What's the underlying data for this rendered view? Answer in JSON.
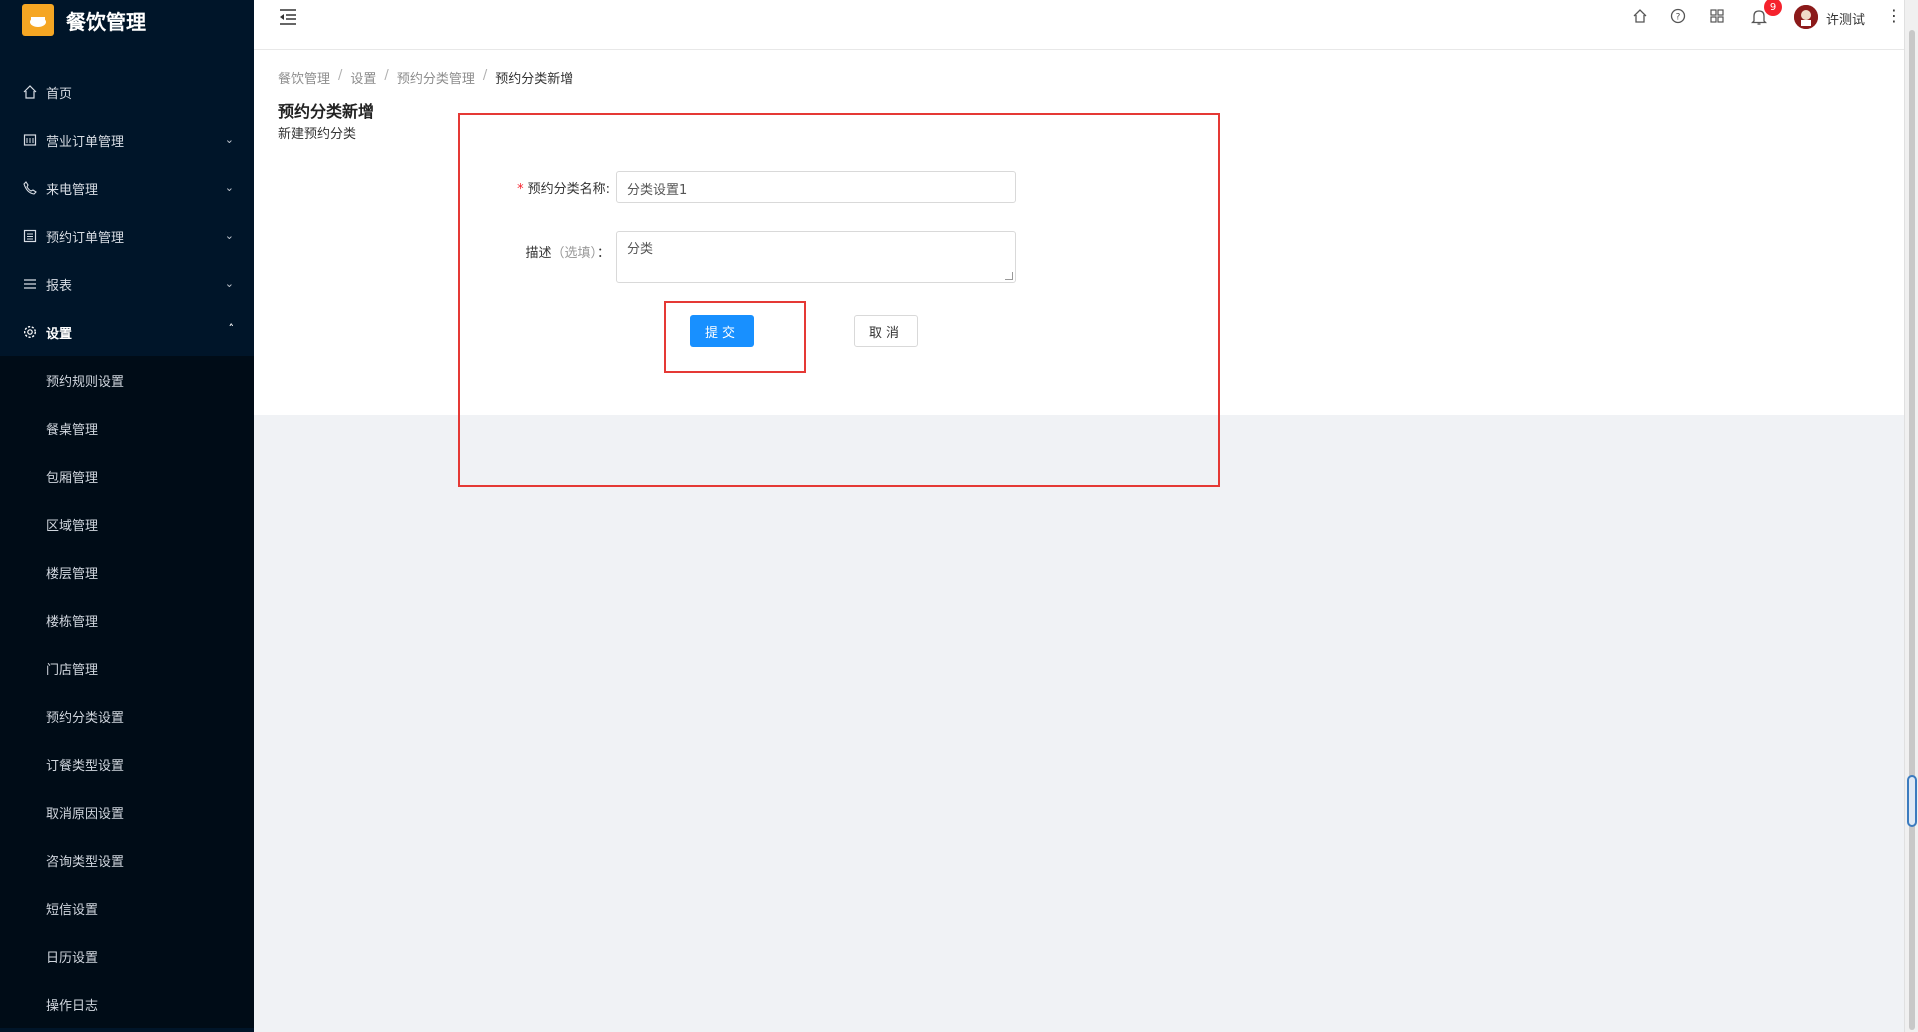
{
  "app": {
    "title": "餐饮管理"
  },
  "sidebar": {
    "items": [
      {
        "label": "首页",
        "icon": "home-icon"
      },
      {
        "label": "营业订单管理",
        "icon": "calendar-icon",
        "expandable": true
      },
      {
        "label": "来电管理",
        "icon": "phone-icon",
        "expandable": true
      },
      {
        "label": "预约订单管理",
        "icon": "list-icon",
        "expandable": true
      },
      {
        "label": "报表",
        "icon": "menu-icon",
        "expandable": true
      },
      {
        "label": "设置",
        "icon": "gear-icon",
        "expanded": true
      }
    ],
    "settings_sub": [
      "预约规则设置",
      "餐桌管理",
      "包厢管理",
      "区域管理",
      "楼层管理",
      "楼栋管理",
      "门店管理",
      "预约分类设置",
      "订餐类型设置",
      "取消原因设置",
      "咨询类型设置",
      "短信设置",
      "日历设置",
      "操作日志"
    ]
  },
  "header": {
    "notification_count": "9",
    "username": "许测试",
    "icons": [
      "home-icon",
      "help-icon",
      "apps-icon",
      "bell-icon",
      "avatar",
      "more-icon"
    ]
  },
  "breadcrumb": [
    "餐饮管理",
    "设置",
    "预约分类管理",
    "预约分类新增"
  ],
  "page": {
    "title": "预约分类新增",
    "description": "新建预约分类"
  },
  "form": {
    "name_label": "预约分类名称:",
    "name_value": "分类设置1",
    "desc_label": "描述",
    "desc_hint": "（选填）",
    "desc_colon": "：",
    "desc_value": "分类",
    "submit_label": "提交",
    "cancel_label": "取消"
  },
  "colors": {
    "sidebar_bg": "#001529",
    "primary": "#1890ff",
    "highlight": "#e53935",
    "badge": "#f5222d"
  }
}
